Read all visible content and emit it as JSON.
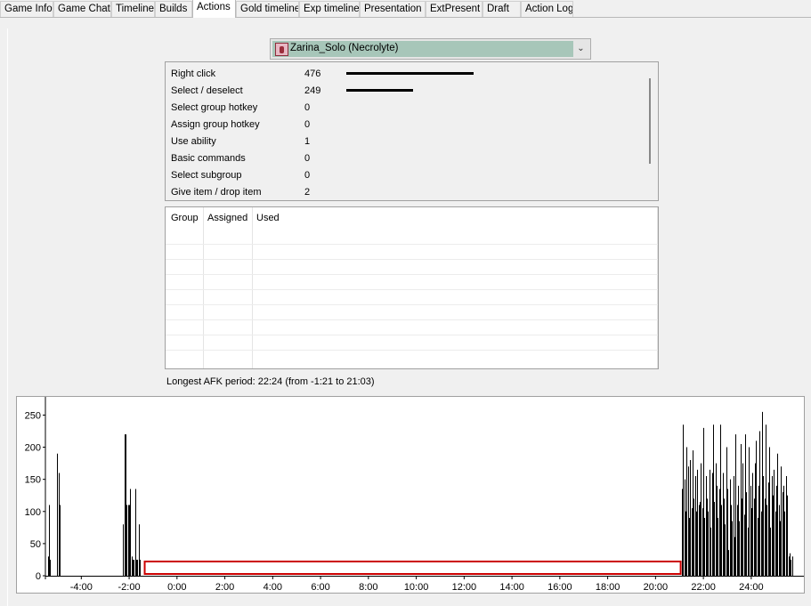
{
  "tabs": [
    {
      "label": "Game Info",
      "active": false
    },
    {
      "label": "Game Chat",
      "active": false
    },
    {
      "label": "Timeline",
      "active": false
    },
    {
      "label": "Builds",
      "active": false
    },
    {
      "label": "Actions",
      "active": true
    },
    {
      "label": "Gold timeline",
      "active": false
    },
    {
      "label": "Exp timeline",
      "active": false
    },
    {
      "label": "Presentation",
      "active": false
    },
    {
      "label": "ExtPresent",
      "active": false
    },
    {
      "label": "Draft",
      "active": false
    },
    {
      "label": "Action Log",
      "active": false
    }
  ],
  "player_select": {
    "value": "Zarina_Solo (Necrolyte)",
    "icon": "hero-portrait-icon"
  },
  "actions": [
    {
      "label": "Right click",
      "count": "476",
      "value": 476
    },
    {
      "label": "Select / deselect",
      "count": "249",
      "value": 249
    },
    {
      "label": "Select group hotkey",
      "count": "0",
      "value": 0
    },
    {
      "label": "Assign group hotkey",
      "count": "0",
      "value": 0
    },
    {
      "label": "Use ability",
      "count": "1",
      "value": 1
    },
    {
      "label": "Basic commands",
      "count": "0",
      "value": 0
    },
    {
      "label": "Select subgroup",
      "count": "0",
      "value": 0
    },
    {
      "label": "Give item / drop item",
      "count": "2",
      "value": 2
    }
  ],
  "groups_table": {
    "columns": [
      "Group",
      "Assigned",
      "Used"
    ],
    "rows": []
  },
  "afk_text": "Longest AFK period: 22:24 (from -1:21 to 21:03)",
  "chart_data": {
    "type": "bar",
    "title": "",
    "xlabel": "",
    "ylabel": "",
    "x_unit": "game time (minutes)",
    "xlim": [
      -5.5,
      26.2
    ],
    "ylim": [
      0,
      260
    ],
    "y_ticks": [
      0,
      50,
      100,
      150,
      200,
      250
    ],
    "x_ticks": [
      {
        "value": -4,
        "label": "-4:00"
      },
      {
        "value": -2,
        "label": "-2:00"
      },
      {
        "value": 0,
        "label": "0:00"
      },
      {
        "value": 2,
        "label": "2:00"
      },
      {
        "value": 4,
        "label": "4:00"
      },
      {
        "value": 6,
        "label": "6:00"
      },
      {
        "value": 8,
        "label": "8:00"
      },
      {
        "value": 10,
        "label": "10:00"
      },
      {
        "value": 12,
        "label": "12:00"
      },
      {
        "value": 14,
        "label": "14:00"
      },
      {
        "value": 16,
        "label": "16:00"
      },
      {
        "value": 18,
        "label": "18:00"
      },
      {
        "value": 20,
        "label": "20:00"
      },
      {
        "value": 22,
        "label": "22:00"
      },
      {
        "value": 24,
        "label": "24:00"
      }
    ],
    "bars": [
      {
        "x": -5.4,
        "y": 30
      },
      {
        "x": -5.35,
        "y": 110
      },
      {
        "x": -5.3,
        "y": 25
      },
      {
        "x": -5.0,
        "y": 190
      },
      {
        "x": -4.95,
        "y": 160
      },
      {
        "x": -4.9,
        "y": 110
      },
      {
        "x": -2.25,
        "y": 80
      },
      {
        "x": -2.2,
        "y": 220
      },
      {
        "x": -2.15,
        "y": 220
      },
      {
        "x": -2.1,
        "y": 110
      },
      {
        "x": -2.05,
        "y": 110
      },
      {
        "x": -2.0,
        "y": 110
      },
      {
        "x": -1.95,
        "y": 135
      },
      {
        "x": -1.9,
        "y": 30
      },
      {
        "x": -1.85,
        "y": 25
      },
      {
        "x": -1.8,
        "y": 25
      },
      {
        "x": -1.75,
        "y": 135
      },
      {
        "x": -1.7,
        "y": 25
      },
      {
        "x": -1.65,
        "y": 25
      },
      {
        "x": -1.6,
        "y": 80
      },
      {
        "x": -1.55,
        "y": 25
      },
      {
        "x": 21.1,
        "y": 135
      },
      {
        "x": 21.15,
        "y": 235
      },
      {
        "x": 21.2,
        "y": 150
      },
      {
        "x": 21.25,
        "y": 100
      },
      {
        "x": 21.3,
        "y": 200
      },
      {
        "x": 21.35,
        "y": 170
      },
      {
        "x": 21.4,
        "y": 90
      },
      {
        "x": 21.45,
        "y": 180
      },
      {
        "x": 21.5,
        "y": 105
      },
      {
        "x": 21.55,
        "y": 195
      },
      {
        "x": 21.6,
        "y": 120
      },
      {
        "x": 21.65,
        "y": 155
      },
      {
        "x": 21.7,
        "y": 100
      },
      {
        "x": 21.75,
        "y": 165
      },
      {
        "x": 21.8,
        "y": 110
      },
      {
        "x": 21.85,
        "y": 115
      },
      {
        "x": 21.9,
        "y": 175
      },
      {
        "x": 21.95,
        "y": 105
      },
      {
        "x": 22.0,
        "y": 230
      },
      {
        "x": 22.05,
        "y": 90
      },
      {
        "x": 22.1,
        "y": 155
      },
      {
        "x": 22.15,
        "y": 120
      },
      {
        "x": 22.2,
        "y": 100
      },
      {
        "x": 22.25,
        "y": 165
      },
      {
        "x": 22.3,
        "y": 75
      },
      {
        "x": 22.35,
        "y": 160
      },
      {
        "x": 22.4,
        "y": 235
      },
      {
        "x": 22.45,
        "y": 115
      },
      {
        "x": 22.5,
        "y": 175
      },
      {
        "x": 22.55,
        "y": 140
      },
      {
        "x": 22.6,
        "y": 90
      },
      {
        "x": 22.65,
        "y": 135
      },
      {
        "x": 22.7,
        "y": 235
      },
      {
        "x": 22.75,
        "y": 110
      },
      {
        "x": 22.8,
        "y": 160
      },
      {
        "x": 22.85,
        "y": 120
      },
      {
        "x": 22.9,
        "y": 80
      },
      {
        "x": 22.95,
        "y": 200
      },
      {
        "x": 23.0,
        "y": 135
      },
      {
        "x": 23.05,
        "y": 40
      },
      {
        "x": 23.1,
        "y": 150
      },
      {
        "x": 23.15,
        "y": 110
      },
      {
        "x": 23.2,
        "y": 85
      },
      {
        "x": 23.25,
        "y": 155
      },
      {
        "x": 23.3,
        "y": 60
      },
      {
        "x": 23.35,
        "y": 220
      },
      {
        "x": 23.4,
        "y": 110
      },
      {
        "x": 23.45,
        "y": 140
      },
      {
        "x": 23.5,
        "y": 85
      },
      {
        "x": 23.55,
        "y": 205
      },
      {
        "x": 23.6,
        "y": 120
      },
      {
        "x": 23.65,
        "y": 175
      },
      {
        "x": 23.7,
        "y": 95
      },
      {
        "x": 23.75,
        "y": 220
      },
      {
        "x": 23.8,
        "y": 130
      },
      {
        "x": 23.85,
        "y": 75
      },
      {
        "x": 23.9,
        "y": 200
      },
      {
        "x": 23.95,
        "y": 140
      },
      {
        "x": 24.0,
        "y": 105
      },
      {
        "x": 24.05,
        "y": 160
      },
      {
        "x": 24.1,
        "y": 120
      },
      {
        "x": 24.15,
        "y": 175
      },
      {
        "x": 24.2,
        "y": 210
      },
      {
        "x": 24.25,
        "y": 90
      },
      {
        "x": 24.3,
        "y": 140
      },
      {
        "x": 24.35,
        "y": 225
      },
      {
        "x": 24.4,
        "y": 100
      },
      {
        "x": 24.45,
        "y": 255
      },
      {
        "x": 24.5,
        "y": 155
      },
      {
        "x": 24.55,
        "y": 120
      },
      {
        "x": 24.6,
        "y": 235
      },
      {
        "x": 24.65,
        "y": 110
      },
      {
        "x": 24.7,
        "y": 145
      },
      {
        "x": 24.75,
        "y": 200
      },
      {
        "x": 24.8,
        "y": 75
      },
      {
        "x": 24.85,
        "y": 155
      },
      {
        "x": 24.9,
        "y": 125
      },
      {
        "x": 24.95,
        "y": 165
      },
      {
        "x": 25.0,
        "y": 100
      },
      {
        "x": 25.05,
        "y": 140
      },
      {
        "x": 25.1,
        "y": 190
      },
      {
        "x": 25.15,
        "y": 110
      },
      {
        "x": 25.2,
        "y": 85
      },
      {
        "x": 25.25,
        "y": 170
      },
      {
        "x": 25.3,
        "y": 130
      },
      {
        "x": 25.35,
        "y": 140
      },
      {
        "x": 25.4,
        "y": 100
      },
      {
        "x": 25.45,
        "y": 155
      },
      {
        "x": 25.5,
        "y": 125
      },
      {
        "x": 25.55,
        "y": 30
      },
      {
        "x": 25.6,
        "y": 35
      },
      {
        "x": 25.65,
        "y": 25
      },
      {
        "x": 25.7,
        "y": 30
      }
    ],
    "afk_highlight": {
      "from": -1.35,
      "to": 21.05,
      "color": "#cc0000"
    },
    "bar_color": "#000000",
    "grid": false
  }
}
